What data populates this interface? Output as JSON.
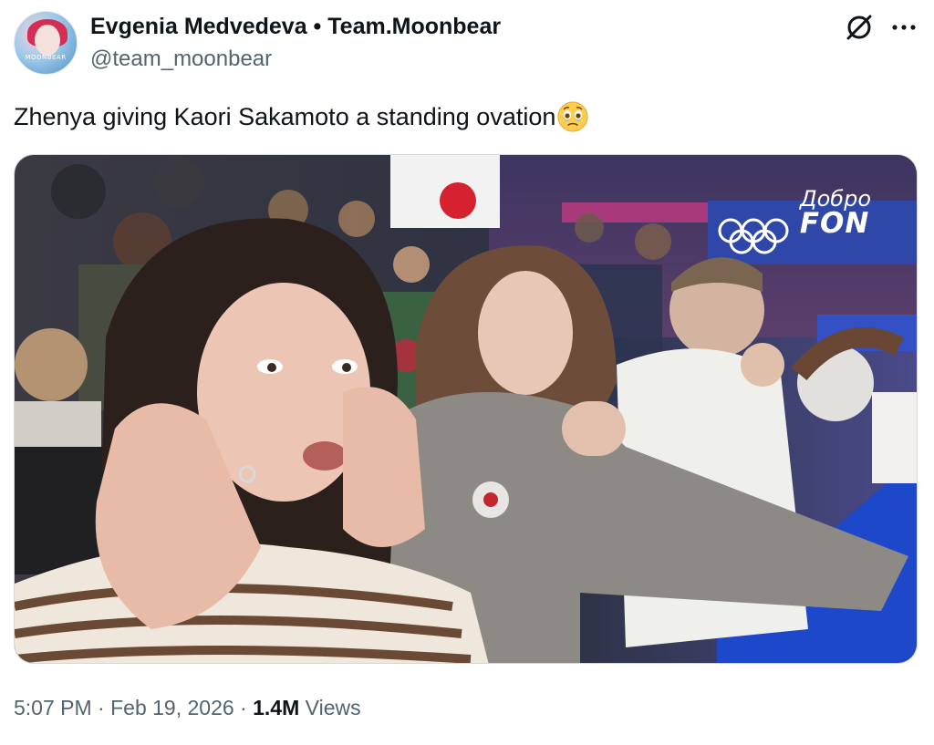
{
  "author": {
    "display_name": "Evgenia Medvedeva • Team.Moonbear",
    "handle": "@team_moonbear",
    "avatar_text": "MOONBEAR",
    "avatar_icon": "avatar-portrait"
  },
  "header_actions": {
    "grok_icon": "grok-icon",
    "more_icon": "more-horizontal-icon"
  },
  "tweet": {
    "text": "Zhenya giving Kaori Sakamoto a standing ovation",
    "emoji": "face-holding-back-tears-emoji"
  },
  "media": {
    "watermark_line1": "Добро",
    "watermark_line2": "FON"
  },
  "meta": {
    "time": "5:07 PM",
    "separator1": " · ",
    "date": "Feb 19, 2026",
    "separator2": " · ",
    "views_count": "1.4M",
    "views_label": " Views"
  },
  "colors": {
    "text_primary": "#0f1419",
    "text_secondary": "#536471",
    "border": "#cfd9de"
  }
}
